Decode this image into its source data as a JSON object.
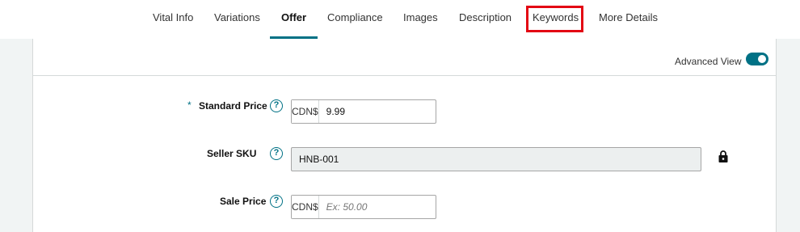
{
  "tabs": [
    {
      "label": "Vital Info",
      "active": false
    },
    {
      "label": "Variations",
      "active": false
    },
    {
      "label": "Offer",
      "active": true
    },
    {
      "label": "Compliance",
      "active": false
    },
    {
      "label": "Images",
      "active": false
    },
    {
      "label": "Description",
      "active": false
    },
    {
      "label": "Keywords",
      "active": false,
      "highlighted": true
    },
    {
      "label": "More Details",
      "active": false
    }
  ],
  "annotation": {
    "highlight_color": "#e30613",
    "arrow_icon": "up-arrow-icon"
  },
  "header": {
    "advanced_view_label": "Advanced View",
    "advanced_view_on": true
  },
  "fields": {
    "standard_price": {
      "required_mark": "*",
      "label": "Standard Price",
      "help_icon": "?",
      "currency": "CDN$",
      "value": "9.99"
    },
    "seller_sku": {
      "label": "Seller SKU",
      "help_icon": "?",
      "value": "HNB-001",
      "locked": true
    },
    "sale_price": {
      "label": "Sale Price",
      "help_icon": "?",
      "currency": "CDN$",
      "placeholder": "Ex: 50.00"
    }
  },
  "colors": {
    "accent": "#007185",
    "background": "#f1f4f4"
  }
}
